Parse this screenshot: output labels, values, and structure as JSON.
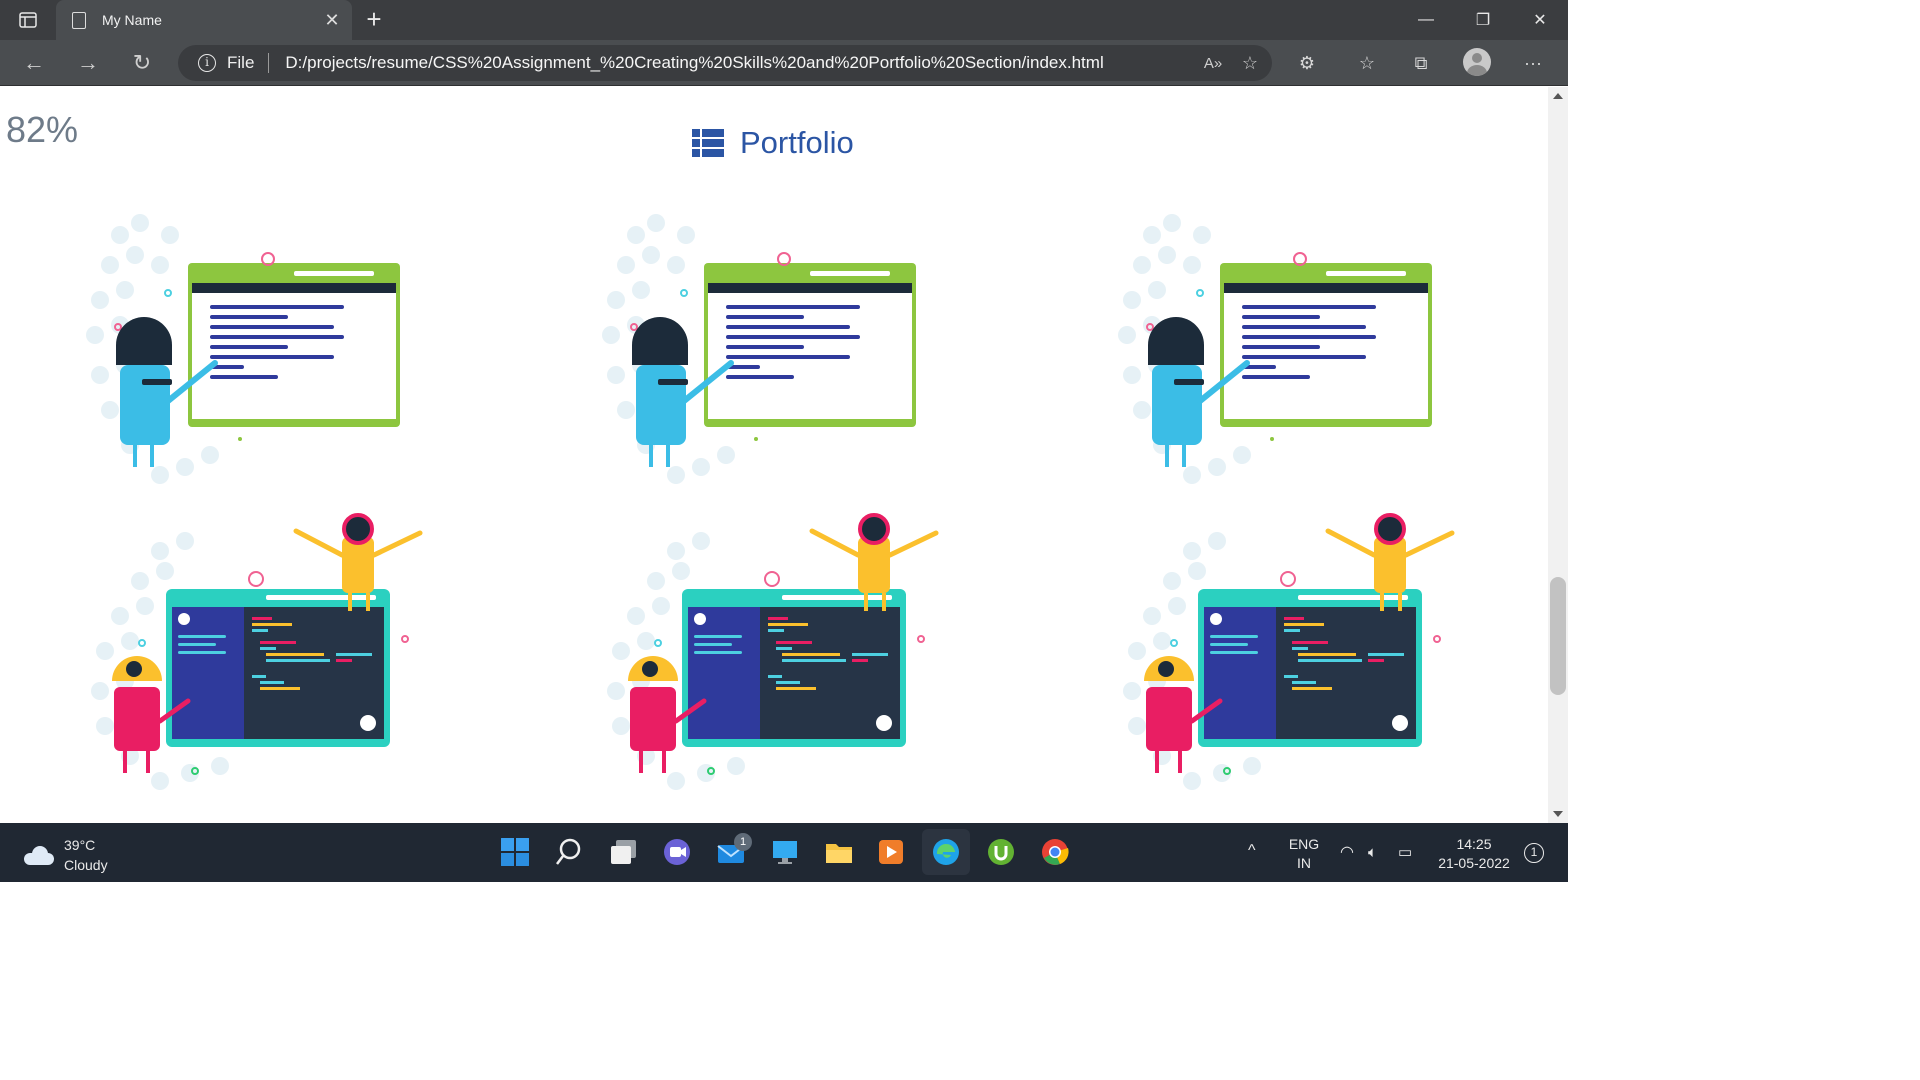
{
  "browser": {
    "tab_title": "My Name",
    "url_scheme": "File",
    "url_path": "D:/projects/resume/CSS%20Assignment_%20Creating%20Skills%20and%20Portfolio%20Section/index.html"
  },
  "page": {
    "percentage": "82%",
    "portfolio_title": "Portfolio",
    "items": [
      {
        "kind": "teacher",
        "colors": {
          "board": "#8dc63f",
          "char": "#3bbde6"
        }
      },
      {
        "kind": "teacher",
        "colors": {
          "board": "#8dc63f",
          "char": "#3bbde6"
        }
      },
      {
        "kind": "teacher",
        "colors": {
          "board": "#8dc63f",
          "char": "#3bbde6"
        }
      },
      {
        "kind": "coder",
        "colors": {
          "board": "#2bd0c0",
          "char": "#e91e63"
        }
      },
      {
        "kind": "coder",
        "colors": {
          "board": "#2bd0c0",
          "char": "#e91e63"
        }
      },
      {
        "kind": "coder",
        "colors": {
          "board": "#2bd0c0",
          "char": "#e91e63"
        }
      }
    ]
  },
  "taskbar": {
    "weather_temp": "39°C",
    "weather_desc": "Cloudy",
    "mail_badge": "1",
    "lang_top": "ENG",
    "lang_bottom": "IN",
    "time": "14:25",
    "date": "21-05-2022",
    "notification_count": "1"
  },
  "colors": {
    "accent": "#2b55a4",
    "percent_text": "#6e7b89"
  }
}
